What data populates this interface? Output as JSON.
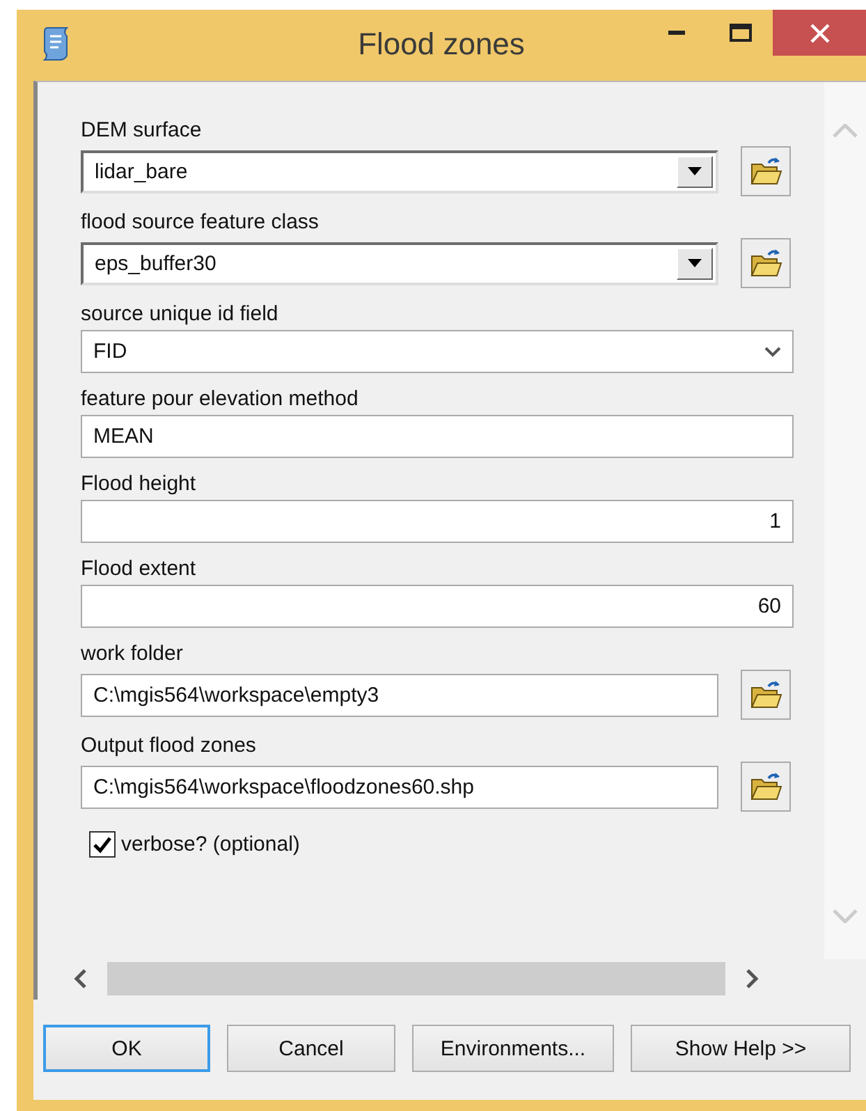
{
  "window": {
    "title": "Flood zones"
  },
  "parameters": [
    {
      "kind": "combo",
      "label": "DEM surface",
      "value": "lidar_bare"
    },
    {
      "kind": "combo",
      "label": "flood source feature class",
      "value": "eps_buffer30"
    },
    {
      "kind": "select",
      "label": "source unique id field",
      "value": "FID"
    },
    {
      "kind": "text",
      "label": "feature pour elevation method",
      "value": "MEAN"
    },
    {
      "kind": "number",
      "label": "Flood height",
      "value": "1"
    },
    {
      "kind": "number",
      "label": "Flood extent",
      "value": "60"
    },
    {
      "kind": "path",
      "label": "work folder",
      "value": "C:\\mgis564\\workspace\\empty3"
    },
    {
      "kind": "path",
      "label": "Output flood zones",
      "value": "C:\\mgis564\\workspace\\floodzones60.shp"
    }
  ],
  "checkbox": {
    "label": "verbose? (optional)",
    "checked": true
  },
  "buttons": [
    {
      "label": "OK",
      "focused": true
    },
    {
      "label": "Cancel",
      "focused": false
    },
    {
      "label": "Environments...",
      "focused": false
    },
    {
      "label": "Show Help >>",
      "focused": false
    }
  ]
}
